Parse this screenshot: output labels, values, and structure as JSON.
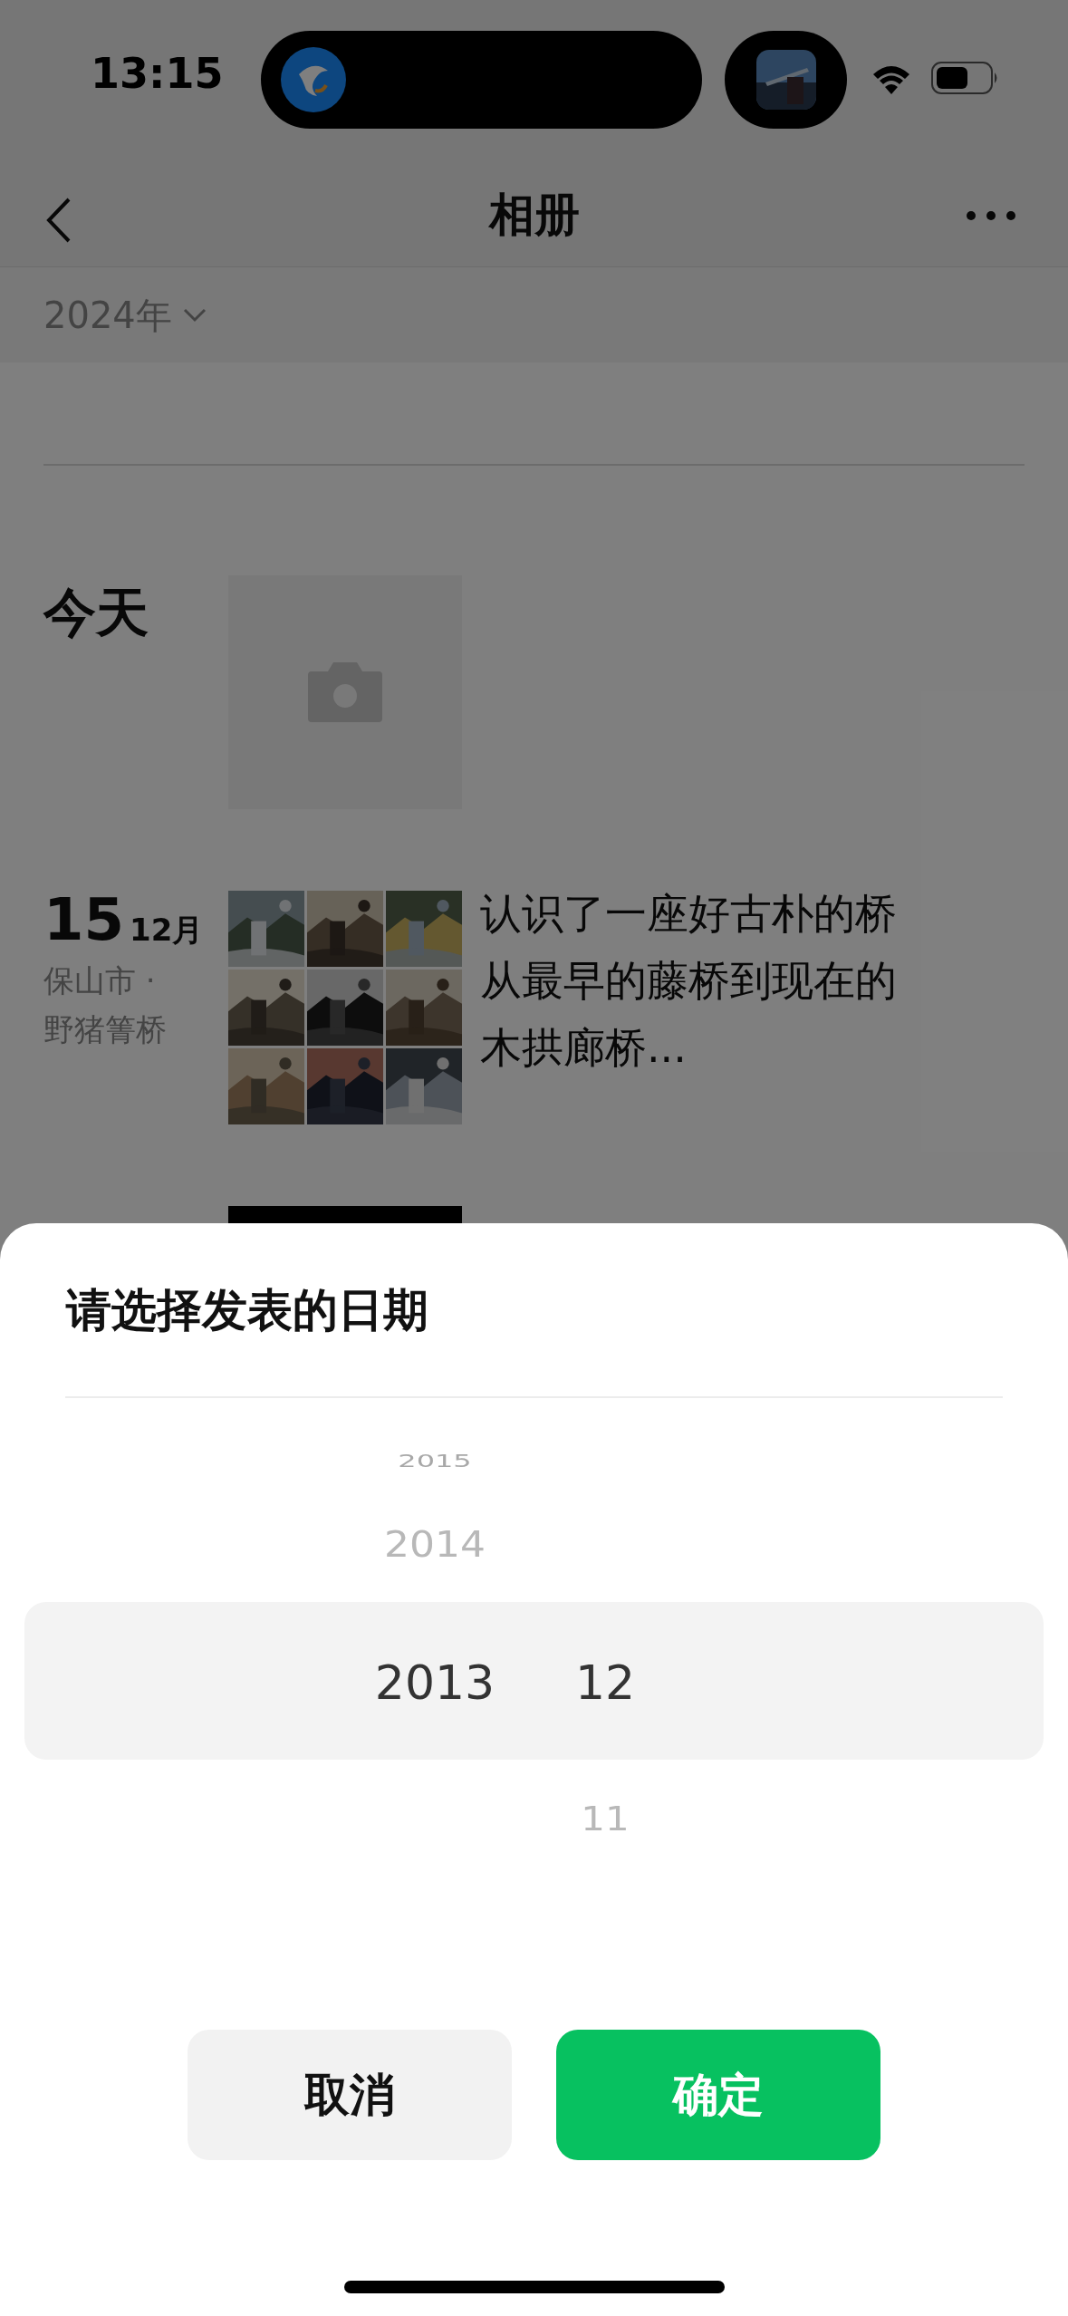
{
  "status_bar": {
    "time": "13:15"
  },
  "nav": {
    "title": "相册"
  },
  "filter": {
    "year": "2024年"
  },
  "entries": [
    {
      "kind": "today",
      "date": "今天"
    },
    {
      "kind": "post",
      "day": "15",
      "month": "12月",
      "location": [
        "保山市 ·",
        "野猪箐桥"
      ],
      "text": "认识了一座好古朴的桥从最早的藤桥到现在的木拱廊桥...",
      "photos": [
        {
          "kind": "picture"
        },
        {
          "kind": "picture"
        },
        {
          "kind": "picture"
        },
        {
          "kind": "picture"
        },
        {
          "kind": "picture"
        },
        {
          "kind": "picture"
        },
        {
          "kind": "picture"
        },
        {
          "kind": "picture"
        },
        {
          "kind": "picture"
        }
      ]
    },
    {
      "kind": "partial"
    }
  ],
  "sheet": {
    "title": "请选择发表的日期",
    "columns": [
      {
        "items": [
          {
            "label": "2015",
            "selected": false
          },
          {
            "label": "2014",
            "selected": false
          },
          {
            "label": "2013",
            "selected": true
          }
        ]
      },
      {
        "items": [
          {
            "label": "12",
            "selected": true
          },
          {
            "label": "11",
            "selected": false
          }
        ]
      }
    ],
    "buttons": [
      {
        "label": "取消",
        "kind": "cancel"
      },
      {
        "label": "确定",
        "kind": "confirm"
      }
    ]
  }
}
